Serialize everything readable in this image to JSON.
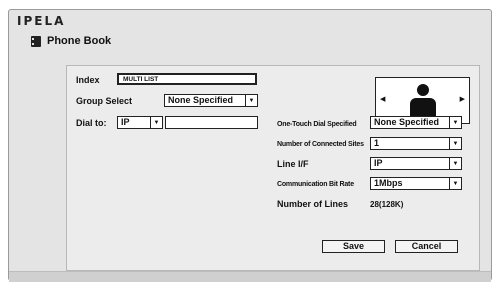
{
  "brand": {
    "logo_text": "IPELA"
  },
  "header": {
    "title": "Phone Book",
    "icon": "phone-book-icon"
  },
  "left": {
    "index_label": "Index",
    "index_value": "MULTI LIST",
    "group_label": "Group Select",
    "group_value": "None Specified",
    "dial_label": "Dial to:",
    "dial_type_value": "IP",
    "dial_address_value": ""
  },
  "right": {
    "one_touch_label": "One-Touch Dial Specified",
    "one_touch_value": "None Specified",
    "sites_label": "Number of Connected Sites",
    "sites_value": "1",
    "line_if_label": "Line I/F",
    "line_if_value": "IP",
    "bitrate_label": "Communication Bit Rate",
    "bitrate_value": "1Mbps",
    "lines_label": "Number of Lines",
    "lines_value": "28(128K)"
  },
  "preview": {
    "prev_glyph": "◀",
    "next_glyph": "▶",
    "icon": "person-icon"
  },
  "dropdown_glyph": "▼",
  "buttons": {
    "save": "Save",
    "cancel": "Cancel"
  }
}
